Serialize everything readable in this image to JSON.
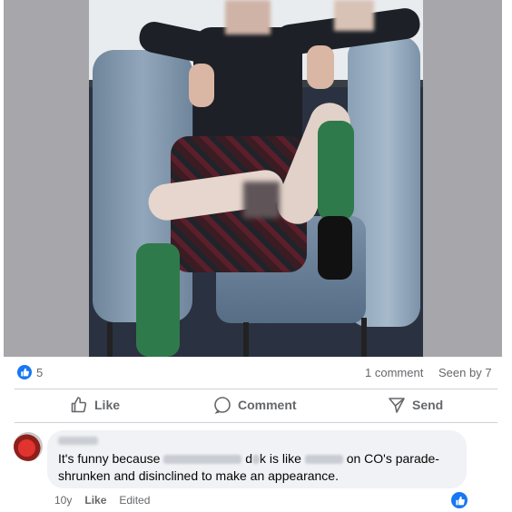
{
  "post": {
    "reactions": {
      "count": "5",
      "icon": "like-icon",
      "color": "#1877f2"
    },
    "comments_count": "1 comment",
    "seen_by": "Seen by 7"
  },
  "actions": {
    "like_label": "Like",
    "comment_label": "Comment",
    "send_label": "Send"
  },
  "comment": {
    "text_part1": "It's funny because",
    "text_part2": "d",
    "text_part3": "k is like",
    "text_part4": "on CO's parade-",
    "text_line2": "shrunken and disinclined to make an appearance.",
    "meta": {
      "age": "10y",
      "like_label": "Like",
      "edited_label": "Edited"
    },
    "reaction_icon": "like-icon"
  }
}
